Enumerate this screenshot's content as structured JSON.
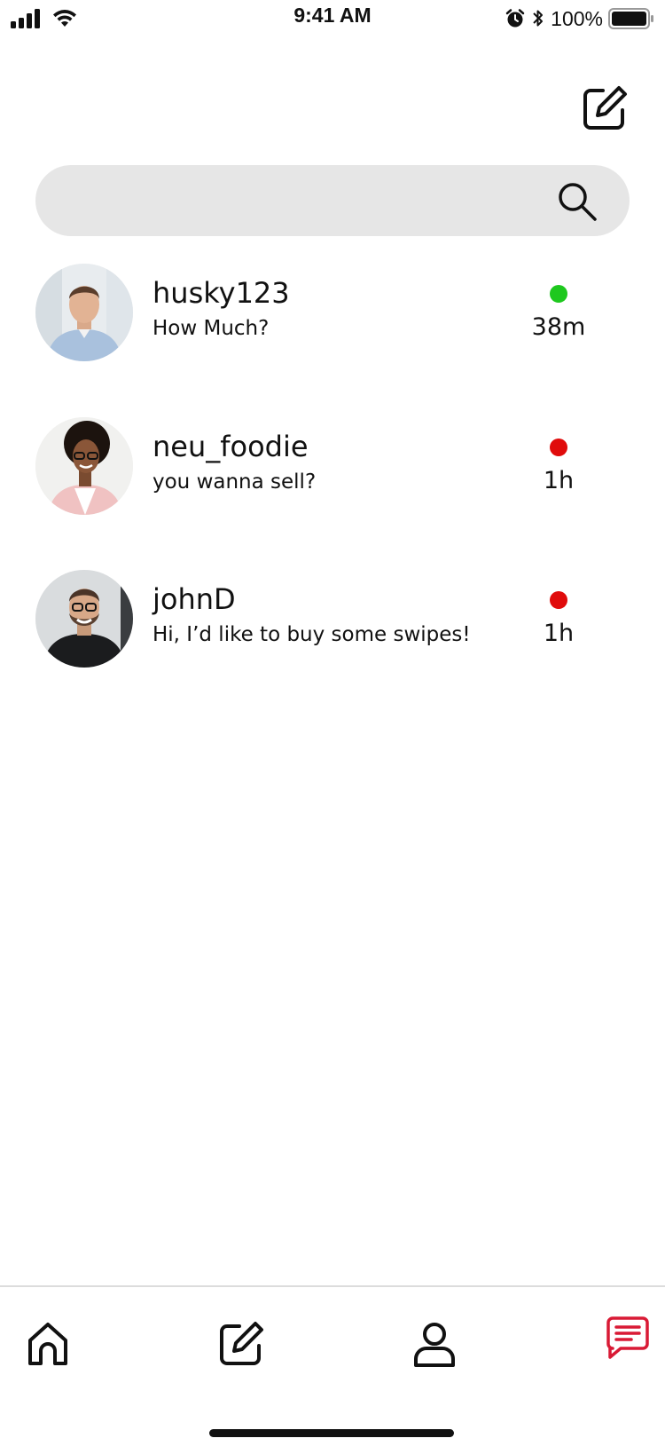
{
  "status_bar": {
    "time": "9:41 AM",
    "battery_percent": "100%",
    "icons": [
      "signal-icon",
      "wifi-icon",
      "alarm-icon",
      "bluetooth-icon",
      "battery-icon"
    ]
  },
  "header": {
    "compose_icon": "compose-icon"
  },
  "search": {
    "placeholder": "",
    "value": "",
    "icon": "search-icon"
  },
  "conversations": [
    {
      "username": "husky123",
      "last_message": "How Much?",
      "time": "38m",
      "status_color": "#1ec81e",
      "avatar": "avatar-photo"
    },
    {
      "username": "neu_foodie",
      "last_message": "you wanna sell?",
      "time": "1h",
      "status_color": "#e00b0b",
      "avatar": "avatar-photo"
    },
    {
      "username": "johnD",
      "last_message": "Hi, I’d like to buy some swipes!",
      "time": "1h",
      "status_color": "#e00b0b",
      "avatar": "avatar-photo"
    }
  ],
  "bottom_nav": {
    "items": [
      {
        "name": "home",
        "icon": "home-icon",
        "active": false
      },
      {
        "name": "post",
        "icon": "compose-icon",
        "active": false
      },
      {
        "name": "profile",
        "icon": "user-icon",
        "active": false
      },
      {
        "name": "messages",
        "icon": "chat-icon",
        "active": true
      }
    ],
    "active_color": "#d91a35",
    "inactive_color": "#111111"
  }
}
